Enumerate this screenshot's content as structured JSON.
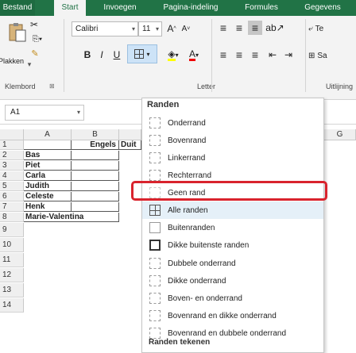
{
  "ribbon_tabs": [
    "Bestand",
    "Start",
    "Invoegen",
    "Pagina-indeling",
    "Formules",
    "Gegevens"
  ],
  "active_tab": "Start",
  "clipboard": {
    "paste_label": "Plakken",
    "group_label": "Klembord"
  },
  "font": {
    "name": "Calibri",
    "size": "11",
    "bold": "B",
    "italic": "I",
    "underline": "U",
    "grow": "A",
    "shrink": "A",
    "font_color": "A",
    "group_label": "Letter"
  },
  "alignment": {
    "group_label": "Uitlijning",
    "wrap_label": "Te",
    "merge_label": "Sa"
  },
  "formula_bar": {
    "name_box": "A1"
  },
  "columns": [
    "A",
    "B",
    "G"
  ],
  "rows": [
    "1",
    "2",
    "3",
    "4",
    "5",
    "6",
    "7",
    "8",
    "9",
    "10",
    "11",
    "12",
    "13",
    "14"
  ],
  "cells": {
    "B1": "Engels",
    "C1": "Duit",
    "names": [
      "Bas",
      "Piet",
      "Carla",
      "Judith",
      "Celeste",
      "Henk",
      "Marie-Valentina"
    ]
  },
  "borders_menu": {
    "title": "Randen",
    "items": [
      "Onderrand",
      "Bovenrand",
      "Linkerrand",
      "Rechterrand",
      "Geen rand",
      "Alle randen",
      "Buitenranden",
      "Dikke buitenste randen",
      "Dubbele onderrand",
      "Dikke onderrand",
      "Boven- en onderrand",
      "Bovenrand en dikke onderrand",
      "Bovenrand en dubbele onderrand"
    ],
    "highlighted_item": "Alle randen",
    "draw_section_title": "Randen tekenen"
  },
  "colors": {
    "excel_green": "#217346",
    "highlight_red": "#d9232d"
  }
}
